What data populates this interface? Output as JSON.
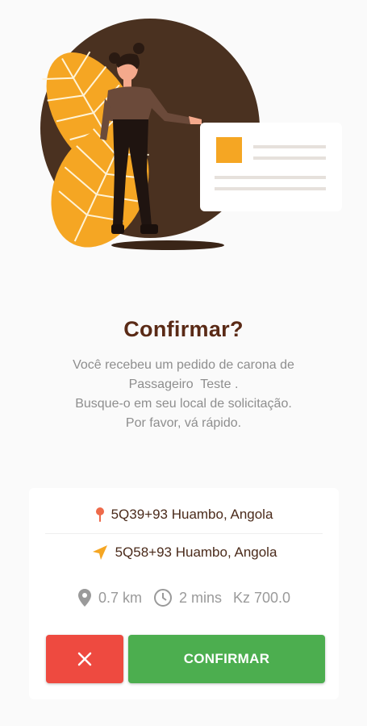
{
  "dialog": {
    "title": "Confirmar?",
    "message_lines": [
      "Você recebeu um pedido de carona de",
      "Passageiro  Teste .",
      "Busque-o em seu local de solicitação.",
      "Por favor, vá rápido."
    ]
  },
  "trip": {
    "pickup": {
      "icon": "pin-icon",
      "address": "5Q39+93 Huambo, Angola"
    },
    "destination": {
      "icon": "navigation-arrow-icon",
      "address": "5Q58+93 Huambo, Angola"
    },
    "distance": {
      "icon": "location-pin-icon",
      "value": "0.7 km"
    },
    "duration": {
      "icon": "clock-icon",
      "value": "2 mins"
    },
    "fare": "Kz 700.0"
  },
  "actions": {
    "cancel_icon": "close-icon",
    "confirm_label": "CONFIRMAR"
  },
  "colors": {
    "title": "#5a2a16",
    "accent_orange": "#f5a623",
    "cancel": "#ee4a40",
    "confirm": "#4cae4f",
    "illustration_brown": "#4a3120"
  }
}
